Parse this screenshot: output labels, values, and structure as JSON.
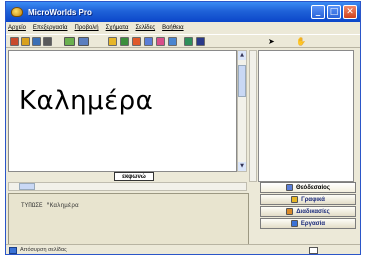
{
  "window": {
    "title": "MicroWorlds Pro"
  },
  "menu": [
    "Αρχείο",
    "Επεξεργασία",
    "Προβολή",
    "Σχήματα",
    "Σελίδες",
    "Βοήθεια"
  ],
  "toolbar": {
    "buttons": [
      "new-page-icon",
      "open-icon",
      "save-icon",
      "print-icon",
      "project-window-icon",
      "page-window-icon",
      "turtle-icon",
      "text-box-icon",
      "button-icon",
      "eye-icon",
      "paint-icon",
      "pencil-icon",
      "shapes-icon",
      "paint-bucket-icon",
      "pointer-icon",
      "hand-icon"
    ],
    "colors": [
      "#c84a2a",
      "#d9a11c",
      "#3a6fb5",
      "#5a5a5a",
      "#6bb04f",
      "#5c7fbf",
      "#e6b628",
      "#3c8f3c",
      "#e05a2a",
      "#5a7ed8",
      "#d94f8a",
      "#4a86d0",
      "#2f8f5a",
      "#2a3a8a",
      "#555555",
      "#555555"
    ]
  },
  "page": {
    "text": "Καλημέρα"
  },
  "command_label": "εκφωνώ",
  "command_center": {
    "text": "ΤΥΠΩΣΕ \"Καλημέρα"
  },
  "side_tabs": [
    {
      "label": "Θεόδεσαίος",
      "icon": "gallery-icon"
    },
    {
      "label": "Γραφικά",
      "icon": "paint-icon"
    },
    {
      "label": "Διαδικασίες",
      "icon": "procedures-icon"
    },
    {
      "label": "Εργασία",
      "icon": "project-icon"
    }
  ],
  "status": {
    "text": "Απόσυρση σελίδας"
  }
}
